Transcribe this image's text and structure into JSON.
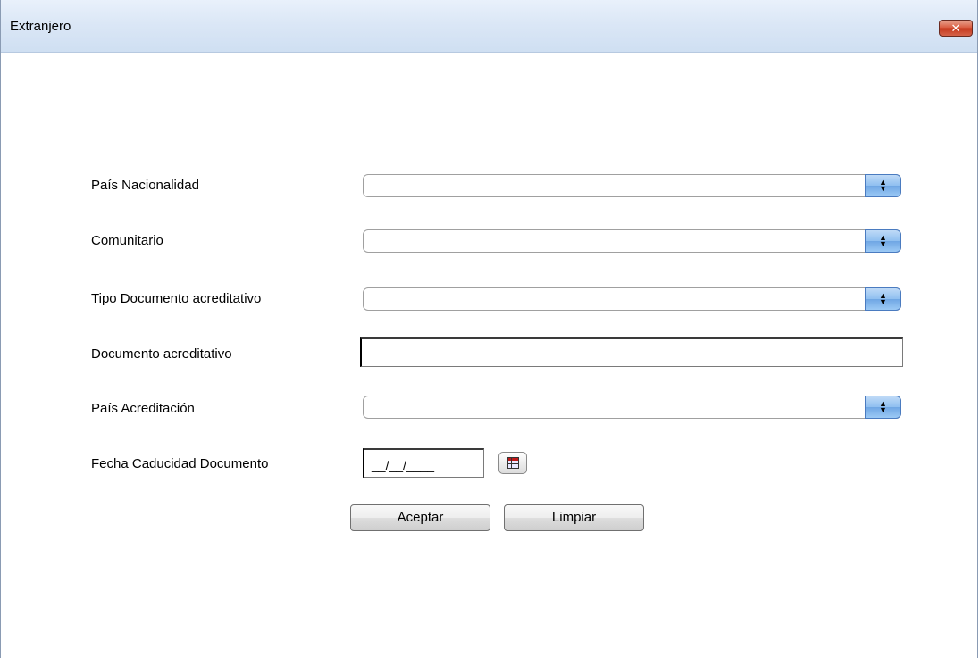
{
  "window": {
    "title": "Extranjero",
    "close_label": "✕"
  },
  "form": {
    "pais_nacionalidad": {
      "label": "País Nacionalidad",
      "value": ""
    },
    "comunitario": {
      "label": "Comunitario",
      "value": ""
    },
    "tipo_documento": {
      "label": "Tipo Documento acreditativo",
      "value": ""
    },
    "documento": {
      "label": "Documento acreditativo",
      "value": ""
    },
    "pais_acreditacion": {
      "label": "País Acreditación",
      "value": ""
    },
    "fecha_caducidad": {
      "label": "Fecha Caducidad Documento",
      "mask": "__/__/____"
    }
  },
  "buttons": {
    "aceptar": "Aceptar",
    "limpiar": "Limpiar"
  },
  "icons": {
    "select_arrow": "updown-arrow-icon",
    "calendar": "calendar-icon",
    "close": "close-icon"
  },
  "colors": {
    "titlebar": "#dbe7f6",
    "select_arrow": "#8fbff0",
    "close_button": "#d8583c"
  }
}
